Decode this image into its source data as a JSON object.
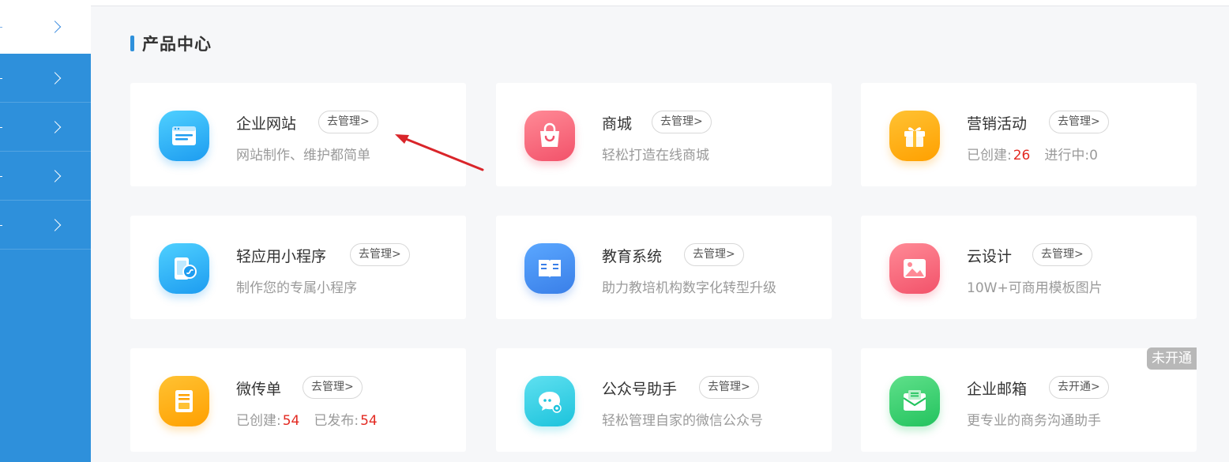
{
  "sidebar": {
    "items": [
      {
        "active": true
      },
      {
        "active": false
      },
      {
        "active": false
      },
      {
        "active": false
      },
      {
        "active": false
      }
    ]
  },
  "section": {
    "title": "产品中心"
  },
  "cards": [
    {
      "name": "企业网站",
      "manage": "去管理>",
      "desc": "网站制作、维护都简单",
      "icon": "website-icon",
      "color": "#1d9cf0"
    },
    {
      "name": "商城",
      "manage": "去管理>",
      "desc": "轻松打造在线商城",
      "icon": "shopping-bag-icon",
      "color": "#f2526a"
    },
    {
      "name": "营销活动",
      "manage": "去管理>",
      "icon": "gift-icon",
      "color": "#ffa000",
      "stats": {
        "created_label": "已创建:",
        "created_value": "26",
        "active_label": "进行中:",
        "active_value": "0"
      }
    },
    {
      "name": "轻应用小程序",
      "manage": "去管理>",
      "desc": "制作您的专属小程序",
      "icon": "mini-program-icon",
      "color": "#1d9cf0"
    },
    {
      "name": "教育系统",
      "manage": "去管理>",
      "desc": "助力教培机构数字化转型升级",
      "icon": "book-icon",
      "color": "#3a7fe8"
    },
    {
      "name": "云设计",
      "manage": "去管理>",
      "desc": "10W+可商用模板图片",
      "icon": "image-icon",
      "color": "#f2526a"
    },
    {
      "name": "微传单",
      "manage": "去管理>",
      "icon": "flyer-icon",
      "color": "#ffa000",
      "stats": {
        "created_label": "已创建:",
        "created_value": "54",
        "published_label": "已发布:",
        "published_value": "54"
      }
    },
    {
      "name": "公众号助手",
      "manage": "去管理>",
      "desc": "轻松管理自家的微信公众号",
      "icon": "wechat-chat-icon",
      "color": "#1cc3dc"
    },
    {
      "name": "企业邮箱",
      "manage": "去开通>",
      "desc": "更专业的商务沟通助手",
      "icon": "mail-icon",
      "color": "#23c35e",
      "badge": "未开通"
    }
  ],
  "colors": {
    "sidebar": "#2e90db",
    "accent": "#2e90db",
    "highlight": "#e32a22",
    "annotation_arrow": "#d9252a"
  }
}
